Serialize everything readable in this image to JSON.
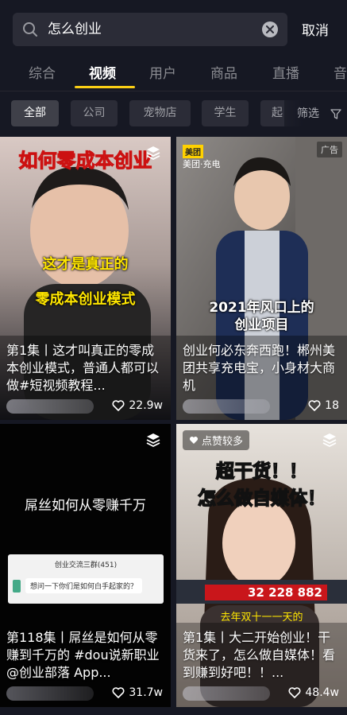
{
  "search": {
    "query": "怎么创业",
    "cancel_label": "取消"
  },
  "tabs": [
    "综合",
    "视频",
    "用户",
    "商品",
    "直播",
    "音"
  ],
  "chips": [
    "全部",
    "公司",
    "宠物店",
    "学生",
    "起"
  ],
  "filter_label": "筛选",
  "cards": [
    {
      "overlay_title": "如何零成本创业",
      "overlay_line1": "这才是真正的",
      "overlay_line2": "零成本创业模式",
      "caption": "第1集丨这才叫真正的零成本创业模式，普通人都可以做#短视频教程...",
      "likes": "22.9w"
    },
    {
      "brand": "美团",
      "brand_sub": "美团·充电",
      "ad": "广告",
      "overlay_line1": "2021年风口上的",
      "overlay_line2": "创业项目",
      "caption": "创业何必东奔西跑！郴州美团共享充电宝，小身材大商机",
      "likes": "18"
    },
    {
      "overlay_title": "屌丝如何从零赚千万",
      "chat_header": "创业交流三群(451)",
      "chat_message": "想问一下你们是如何白手起家的？",
      "caption": "第118集丨屌丝是如何从零赚到千万的 #dou说新职业 @创业部落 App...",
      "likes": "31.7w"
    },
    {
      "hot": "点赞较多",
      "overlay_line1": "超干货！！",
      "overlay_line2": "怎么做自媒体！",
      "amount": "32 228 882",
      "overlay_sub": "去年双十一一天的",
      "caption": "第1集丨大二开始创业！干货来了，怎么做自媒体！看到赚到好吧！！...",
      "likes": "48.4w"
    }
  ],
  "colors": {
    "accent": "#face15",
    "background": "#161823"
  }
}
